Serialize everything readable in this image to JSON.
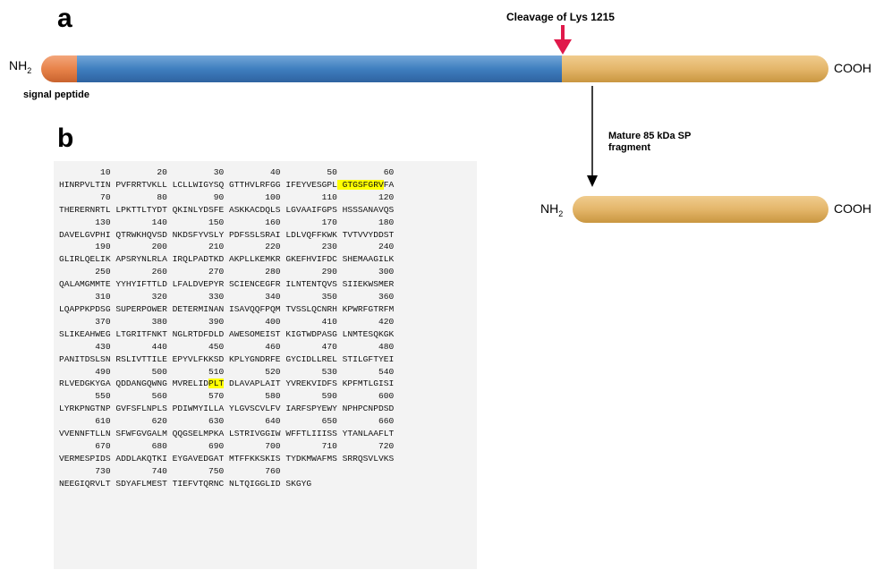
{
  "panel_a": {
    "label": "a",
    "nh2_base": "NH",
    "nh2_sub": "2",
    "cooh": "COOH",
    "signal_peptide": "signal peptide",
    "cleavage": "Cleavage of Lys 1215",
    "colors": {
      "signal": "#e8834a",
      "main": "#3f7fbf",
      "cterm": "#e4b66a",
      "arrow": "#e0194a"
    }
  },
  "mature": {
    "label_line1": "Mature 85 kDa SP",
    "label_line2": "fragment",
    "nh2_base": "NH",
    "nh2_sub": "2",
    "cooh": "COOH"
  },
  "panel_b": {
    "label": "b",
    "highlight_color": "#ffff00",
    "rows": [
      {
        "num": "        10         20         30         40         50         60",
        "seq": [
          {
            "t": "HINRPVLTIN PVFRRTVKLL LCLLWIGYSQ GTTHVLRFGG IFEYVESGPL"
          },
          {
            "t": " GTGSFGRV",
            "h": true
          },
          {
            "t": "FA"
          }
        ]
      },
      {
        "num": "        70         80         90        100        110        120",
        "seq": [
          {
            "t": "THERERNRTL LPKTTLTYDT QKINLYDSFE ASKKACDQLS LGVAAIFGPS HSSSANAVQS"
          }
        ]
      },
      {
        "num": "       130        140        150        160        170        180",
        "seq": [
          {
            "t": "DAVELGVPHI QTRWKHQVSD NKDSFYVSLY PDFSSLSRAI LDLVQFFKWK TVTVVYDDST"
          }
        ]
      },
      {
        "num": "       190        200        210        220        230        240",
        "seq": [
          {
            "t": "GLIRLQELIK APSRYNLRLA IRQLPADTKD AKPLLKEMKR GKEFHVIFDC SHEMAAGILK"
          }
        ]
      },
      {
        "num": "       250        260        270        280        290        300",
        "seq": [
          {
            "t": "QALAMGMMTE YYHYIFTTLD LFALDVEPYR SCIENCEGFR ILNTENTQVS SIIEKWSMER"
          }
        ]
      },
      {
        "num": "       310        320        330        340        350        360",
        "seq": [
          {
            "t": "LQAPPKPDSG SUPERPOWER DETERMINAN ISAVQQFPQM TVSSLQCNRH KPWRFGTRFM"
          }
        ]
      },
      {
        "num": "       370        380        390        400        410        420",
        "seq": [
          {
            "t": "SLIKEAHWEG LTGRITFNKT NGLRTDFDLD AWESOMEIST KIGTWDPASG LNMTESQKGK"
          }
        ]
      },
      {
        "num": "       430        440        450        460        470        480",
        "seq": [
          {
            "t": "PANITDSLSN RSLIVTTILE EPYVLFKKSD KPLYGNDRFE GYCIDLLREL STILGFTYEI"
          }
        ]
      },
      {
        "num": "       490        500        510        520        530        540",
        "seq": [
          {
            "t": "RLVEDGKYGA QDDANGQWNG MVRELID"
          },
          {
            "t": "PLT",
            "h": true
          },
          {
            "t": " DLAVAPLAIT YVREKVIDFS KPFMTLGISI"
          }
        ]
      },
      {
        "num": "       550        560        570        580        590        600",
        "seq": [
          {
            "t": "LYRKPNGTNP GVFSFLNPLS PDIWMYILLA YLGVSCVLFV IARFSPYEWY NPHPCNPDSD"
          }
        ]
      },
      {
        "num": "       610        620        630        640        650        660",
        "seq": [
          {
            "t": "VVENNFTLLN SFWFGVGALM QQGSELMPKA LSTRIVGGIW WFFTLIIISS YTANLAAFLT"
          }
        ]
      },
      {
        "num": "       670        680        690        700        710        720",
        "seq": [
          {
            "t": "VERMESPIDS ADDLAKQTKI EYGAVEDGAT MTFFKKSKIS TYDKMWAFMS SRRQSVLVKS"
          }
        ]
      },
      {
        "num": "       730        740        750        760",
        "seq": [
          {
            "t": "NEEGIQRVLT SDYAFLMEST TIEFVTQRNC NLTQIGGLID SKGYG"
          }
        ]
      }
    ]
  }
}
